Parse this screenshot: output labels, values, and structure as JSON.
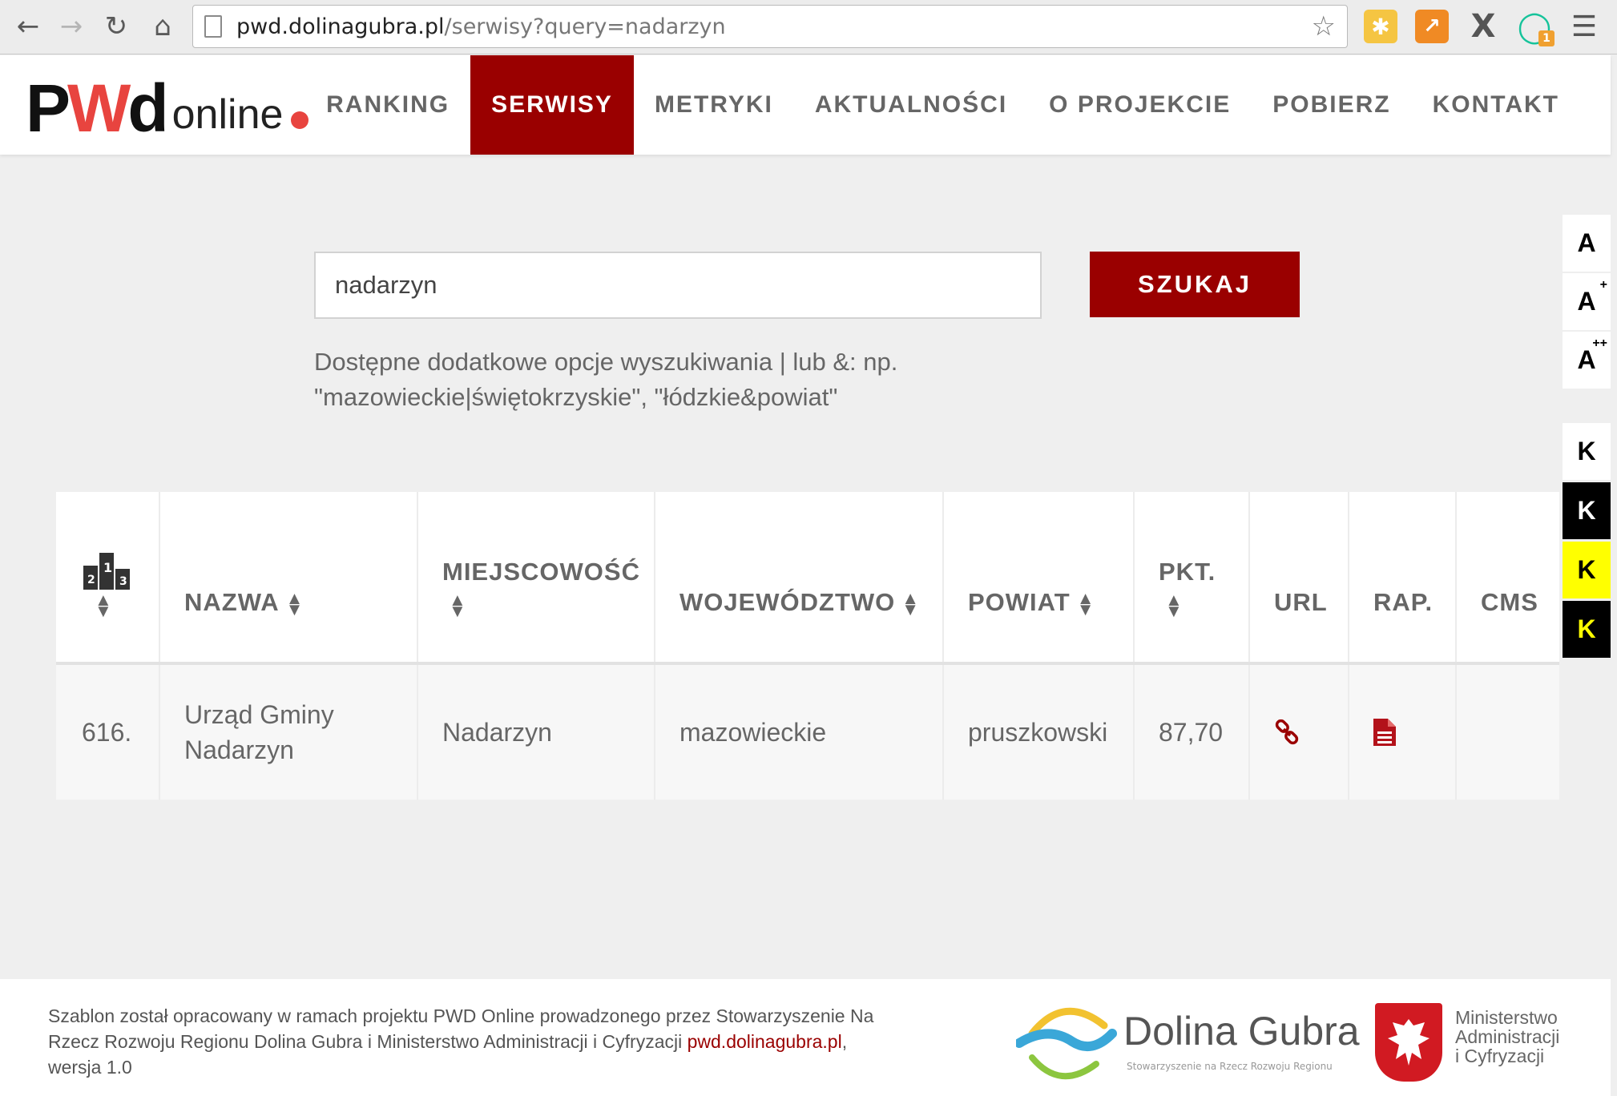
{
  "browser": {
    "url_host": "pwd.dolinagubra.pl",
    "url_path": "/serwisy?query=nadarzyn",
    "icons": [
      "back-icon",
      "forward-icon",
      "reload-icon",
      "home-icon",
      "page-icon",
      "star-icon",
      "extension-icon",
      "chart-extension-icon",
      "x-extension-icon",
      "grammarly-icon",
      "menu-icon"
    ],
    "ext_badge": "1"
  },
  "logo": {
    "pwd_p": "P",
    "pwd_w": "W",
    "pwd_d": "d",
    "online": "online"
  },
  "nav": {
    "items": [
      "RANKING",
      "SERWISY",
      "METRYKI",
      "AKTUALNOŚCI",
      "O PROJEKCIE",
      "POBIERZ",
      "KONTAKT"
    ],
    "active": "SERWISY",
    "accent": "#9a0000"
  },
  "search": {
    "value": "nadarzyn",
    "button": "SZUKAJ",
    "hint_line1": "Dostępne dodatkowe opcje wyszukiwania | lub &: np.",
    "hint_line2": "\"mazowieckie|świętokrzyskie\", \"łódzkie&powiat\""
  },
  "a11y": {
    "font_sizes": [
      {
        "label": "A",
        "sup": ""
      },
      {
        "label": "A",
        "sup": "+"
      },
      {
        "label": "A",
        "sup": "++"
      }
    ],
    "contrast": [
      {
        "label": "K",
        "fg": "#000000",
        "bg": "#ffffff"
      },
      {
        "label": "K",
        "fg": "#ffffff",
        "bg": "#000000"
      },
      {
        "label": "K",
        "fg": "#000000",
        "bg": "#ffff00"
      },
      {
        "label": "K",
        "fg": "#ffff00",
        "bg": "#000000"
      }
    ]
  },
  "table": {
    "headers": {
      "rank_icon": "podium-icon",
      "name": "NAZWA",
      "city": "MIEJSCOWOŚĆ",
      "voivodeship": "WOJEWÓDZTWO",
      "county": "POWIAT",
      "points": "PKT.",
      "url": "URL",
      "report": "RAP.",
      "cms": "CMS"
    },
    "rows": [
      {
        "rank": "616.",
        "name_line1": "Urząd Gminy",
        "name_line2": "Nadarzyn",
        "city": "Nadarzyn",
        "voivodeship": "mazowieckie",
        "county": "pruszkowski",
        "points": "87,70",
        "url_icon": "link-icon",
        "report_icon": "document-icon",
        "cms": ""
      }
    ]
  },
  "footer": {
    "text": "Szablon został opracowany w ramach projektu PWD Online prowadzonego przez Stowarzyszenie Na Rzecz Rozwoju Regionu Dolina Gubra i Ministerstwo Administracji i Cyfryzacji ",
    "link": "pwd.dolinagubra.pl",
    "suffix": ", wersja 1.0",
    "dolina_name": "Dolina Gubra",
    "dolina_sub": "Stowarzyszenie na Rzecz Rozwoju Regionu",
    "ministry_line1": "Ministerstwo",
    "ministry_line2": "Administracji",
    "ministry_line3": "i Cyfryzacji"
  }
}
